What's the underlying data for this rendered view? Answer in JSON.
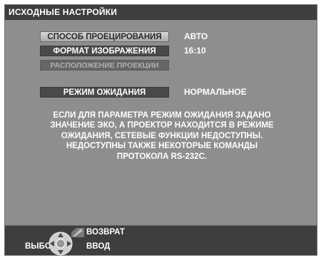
{
  "title": "ИСХОДНЫЕ НАСТРОЙКИ",
  "menu": [
    {
      "label": "СПОСОБ ПРОЕЦИРОВАНИЯ",
      "value": "АВТО",
      "state": "selected"
    },
    {
      "label": "ФОРМАТ ИЗОБРАЖЕНИЯ",
      "value": "16:10",
      "state": "normal"
    },
    {
      "label": "РАСПОЛОЖЕНИЕ ПРОЕКЦИИ",
      "value": "",
      "state": "disabled"
    },
    {
      "label": "РЕЖИМ ОЖИДАНИЯ",
      "value": "НОРМАЛЬНОЕ",
      "state": "normal"
    }
  ],
  "note_lines": [
    "ЕСЛИ ДЛЯ ПАРАМЕТРА РЕЖИМ ОЖИДАНИЯ ЗАДАНО",
    "ЗНАЧЕНИЕ ЭКО, А ПРОЕКТОР НАХОДИТСЯ В РЕЖИМЕ",
    "ОЖИДАНИЯ, СЕТЕВЫЕ ФУНКЦИИ НЕДОСТУПНЫ.",
    "НЕДОСТУПНЫ ТАКЖЕ НЕКОТОРЫЕ КОМАНДЫ",
    "ПРОТОКОЛА RS-232C."
  ],
  "footer": {
    "select_label": "ВЫБОР",
    "return_label": "ВОЗВРАТ",
    "enter_label": "ВВОД",
    "nav_icon": "dpad-icon",
    "return_icon": "return-icon"
  },
  "colors": {
    "osd_background": "#8e8e8e",
    "bar_background": "#3e3e3e",
    "selected_button": "#c4c4c4",
    "normal_button": "#4a4a4a",
    "disabled_button": "#666666"
  }
}
